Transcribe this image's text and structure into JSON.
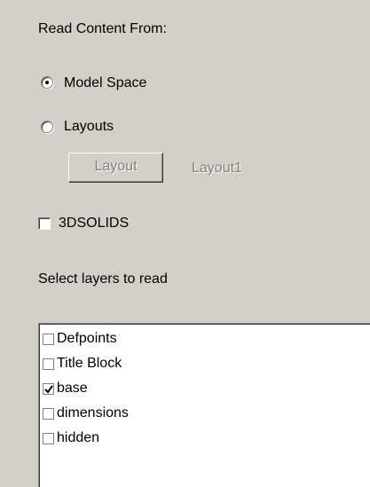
{
  "read_content_label": "Read Content From:",
  "radio_options": [
    {
      "label": "Model Space",
      "selected": true
    },
    {
      "label": "Layouts",
      "selected": false
    }
  ],
  "layout_button_label": "Layout",
  "layout_value": "Layout1",
  "solids_checkbox": {
    "label": "3DSOLIDS",
    "checked": false
  },
  "layers_label": "Select layers to read",
  "layers": [
    {
      "label": "Defpoints",
      "checked": false
    },
    {
      "label": "Title Block",
      "checked": false
    },
    {
      "label": "base",
      "checked": true
    },
    {
      "label": "dimensions",
      "checked": false
    },
    {
      "label": "hidden",
      "checked": false
    }
  ]
}
